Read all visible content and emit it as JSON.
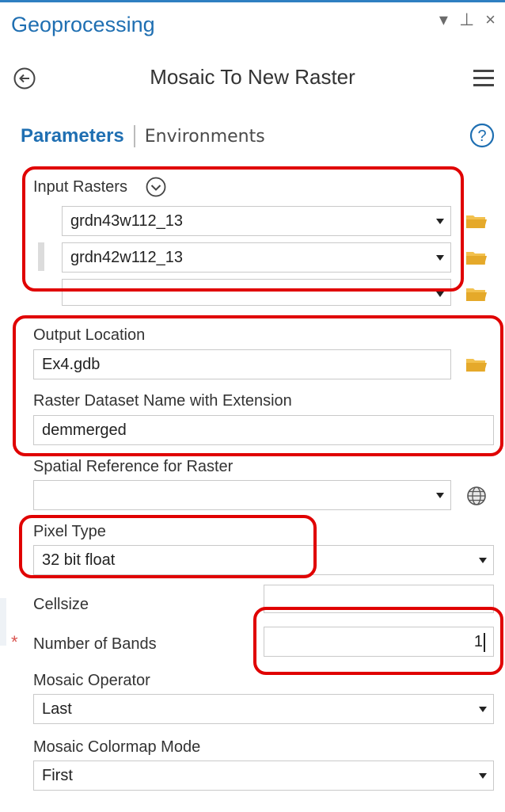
{
  "pane": {
    "title": "Geoprocessing",
    "ctrl_dropdown": "▾",
    "ctrl_pin": "⊥",
    "ctrl_close": "×"
  },
  "tool": {
    "title": "Mosaic To New Raster"
  },
  "tabs": {
    "parameters": "Parameters",
    "environments": "Environments"
  },
  "params": {
    "input_rasters_label": "Input Rasters",
    "input_rasters": [
      "grdn43w112_13",
      "grdn42w112_13",
      ""
    ],
    "output_location_label": "Output Location",
    "output_location": "Ex4.gdb",
    "raster_name_label": "Raster Dataset Name with Extension",
    "raster_name": "demmerged",
    "spatial_ref_label": "Spatial Reference for Raster",
    "spatial_ref": "",
    "pixel_type_label": "Pixel Type",
    "pixel_type": "32 bit float",
    "cellsize_label": "Cellsize",
    "cellsize": "",
    "bands_required_marker": "*",
    "bands_label": "Number of Bands",
    "bands": "1",
    "mosaic_operator_label": "Mosaic Operator",
    "mosaic_operator": "Last",
    "colormap_mode_label": "Mosaic Colormap Mode",
    "colormap_mode": "First"
  },
  "colors": {
    "accent": "#1f6fb2",
    "annotation_red": "#e00000",
    "folder_yellow": "#f2c14e"
  },
  "icons": {
    "back": "back-arrow-circle-icon",
    "menu": "hamburger-menu-icon",
    "help": "help-question-icon",
    "expand": "chevron-down-circle-icon",
    "folder": "folder-icon",
    "globe": "globe-icon"
  }
}
